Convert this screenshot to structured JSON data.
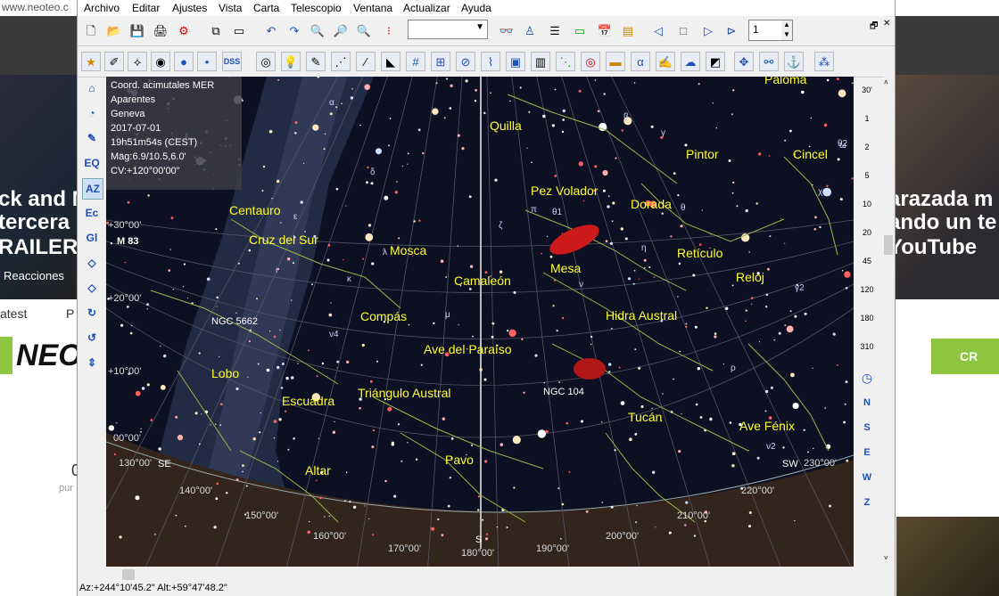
{
  "browser": {
    "url": "www.neoteo.c",
    "left_hero_lines": [
      "ck and M",
      "tercera",
      "RAILER"
    ],
    "left_hero_sub": "Reacciones",
    "right_hero_lines": [
      "arazada m",
      "ando un te",
      "YouTube"
    ],
    "latest": "atest",
    "latest_p": "P",
    "neo_logo": "NEO",
    "create_button": "CR",
    "zero": "0",
    "pur": "pur"
  },
  "menu": [
    "Archivo",
    "Editar",
    "Ajustes",
    "Vista",
    "Carta",
    "Telescopio",
    "Ventana",
    "Actualizar",
    "Ayuda"
  ],
  "toolbar1": {
    "page_value": "1"
  },
  "toolbar2": {
    "dss_label": "DSS"
  },
  "left_toolbar": [
    "EQ",
    "AZ",
    "Ec",
    "Gl"
  ],
  "info": {
    "lines": [
      "Coord. acimutales MER",
      "Aparentes",
      "Geneva",
      "2017-07-01",
      "19h51m54s (CEST)",
      "Mag:6.9/10.5,6.0'",
      "CV:+120°00'00\""
    ]
  },
  "scale": [
    "30'",
    "1",
    "2",
    "5",
    "10",
    "20",
    "45",
    "120",
    "180",
    "310"
  ],
  "directions": [
    "N",
    "S",
    "E",
    "W",
    "Z"
  ],
  "status_text": "Az:+244°10'45.2\"  Alt:+59°47'48.2\"",
  "chart_data": {
    "type": "sky-chart",
    "constellations": [
      "Paloma",
      "Quilla",
      "Pintor",
      "Cincel",
      "Centauro",
      "Pez Volador",
      "Dorada",
      "Cruz del Sur",
      "Mosca",
      "Retículo",
      "Mesa",
      "Reloj",
      "Camaleón",
      "Hidra Austral",
      "Compás",
      "Ave del Paraíso",
      "Lobo",
      "Escuadra",
      "Triángulo Austral",
      "Tucán",
      "Ave Fénix",
      "Pavo",
      "Altar"
    ],
    "objects": [
      "M 83",
      "NGC 5662",
      "NGC 104"
    ],
    "altitude_labels": [
      "+30°00'",
      "+20°00'",
      "+10°00'",
      "00°00'"
    ],
    "azimuth_labels": [
      "130°00'",
      "140°00'",
      "150°00'",
      "160°00'",
      "170°00'",
      "180°00'",
      "190°00'",
      "200°00'",
      "210°00'",
      "220°00'",
      "230°00'"
    ],
    "horizon_markers": [
      "SE",
      "S",
      "SW"
    ],
    "greek_labels": [
      "α",
      "β",
      "γ",
      "δ",
      "ε",
      "ζ",
      "η",
      "θ",
      "ι",
      "κ",
      "λ",
      "μ",
      "ν",
      "π",
      "ρ",
      "ω",
      "χ",
      "γ2",
      "ν2",
      "ν4",
      "θ1",
      "θ2"
    ]
  }
}
